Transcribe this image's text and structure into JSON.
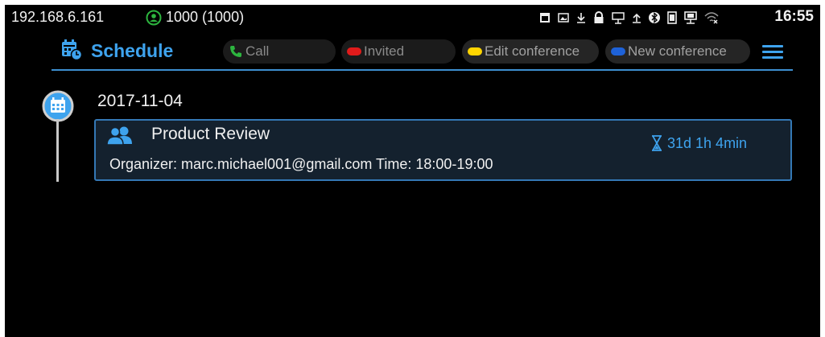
{
  "status_bar": {
    "ip": "192.168.6.161",
    "account": "1000 (1000)",
    "time": "16:55",
    "tray_icons": [
      "calendar-icon",
      "image-icon",
      "download-icon",
      "lock-icon",
      "usb-icon",
      "upload-icon",
      "bluetooth-icon",
      "sim-icon",
      "network-icon",
      "wifi-off-icon"
    ]
  },
  "header": {
    "title": "Schedule",
    "legend": {
      "call": "Call",
      "invited": "Invited",
      "edit_conference": "Edit conference",
      "new_conference": "New conference"
    }
  },
  "schedule": {
    "date": "2017-11-04",
    "meeting": {
      "title": "Product Review",
      "info": "Organizer: marc.michael001@gmail.com Time: 18:00-19:00",
      "countdown": "31d 1h 4min"
    }
  },
  "colors": {
    "accent": "#3ea3ee",
    "call_icon": "#2db53f",
    "invited_dot": "#e11b1b",
    "edit_dot": "#ffd500",
    "new_dot": "#1e62d8",
    "card_bg": "#14212e",
    "card_border": "#3478b5"
  }
}
